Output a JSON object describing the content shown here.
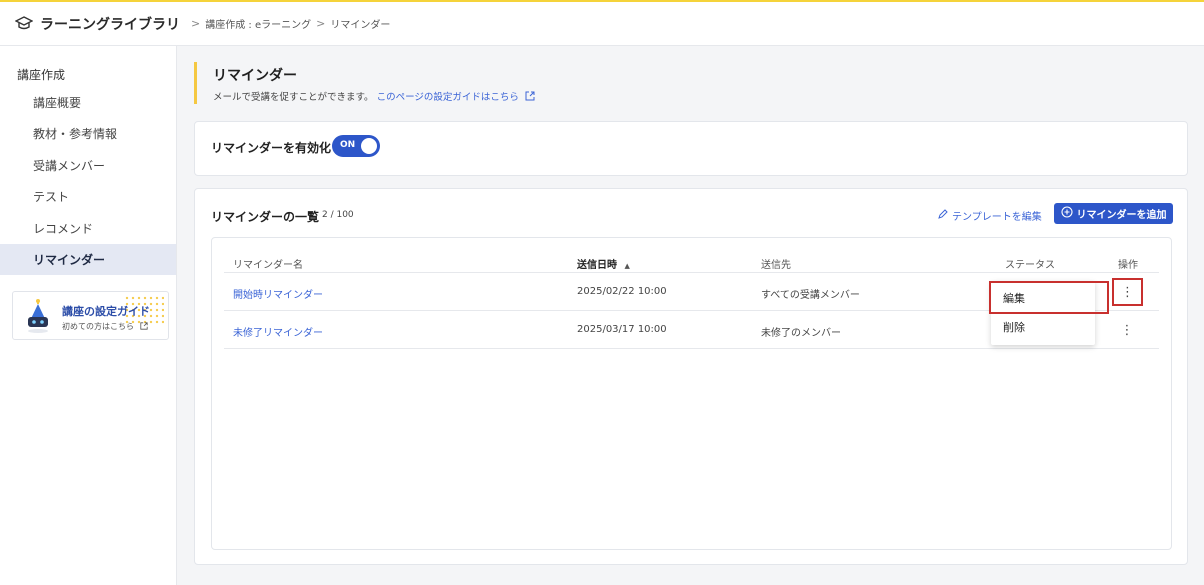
{
  "header": {
    "app_name": "ラーニングライブラリ",
    "breadcrumb": [
      "講座作成 : eラーニング",
      "リマインダー"
    ],
    "separator": ">"
  },
  "sidebar": {
    "section": "講座作成",
    "items": [
      {
        "label": "講座概要",
        "active": false
      },
      {
        "label": "教材・参考情報",
        "active": false
      },
      {
        "label": "受講メンバー",
        "active": false
      },
      {
        "label": "テスト",
        "active": false
      },
      {
        "label": "レコメンド",
        "active": false
      },
      {
        "label": "リマインダー",
        "active": true
      }
    ],
    "guide": {
      "title": "講座の設定ガイド",
      "subtitle": "初めての方はこちら"
    }
  },
  "page": {
    "title": "リマインダー",
    "description": "メールで受講を促すことができます。",
    "guide_link": "このページの設定ガイドはこちら"
  },
  "toggle": {
    "label": "リマインダーを有効化",
    "state": "ON"
  },
  "list": {
    "title": "リマインダーの一覧",
    "count": "2 / 100",
    "template_link": "テンプレートを編集",
    "add_button": "リマインダーを追加",
    "columns": [
      "リマインダー名",
      "送信日時",
      "送信先",
      "ステータス",
      "操作"
    ],
    "sort_indicator": "▲",
    "rows": [
      {
        "name": "開始時リマインダー",
        "datetime": "2025/02/22 10:00",
        "recipients": "すべての受講メンバー",
        "status": ""
      },
      {
        "name": "未修了リマインダー",
        "datetime": "2025/03/17 10:00",
        "recipients": "未修了のメンバー",
        "status": ""
      }
    ]
  },
  "context_menu": {
    "items": [
      "編集",
      "削除"
    ]
  },
  "colors": {
    "accent": "#2d56c9",
    "link": "#3b64d6",
    "highlight": "#c8302e",
    "yellow": "#f5c842"
  }
}
